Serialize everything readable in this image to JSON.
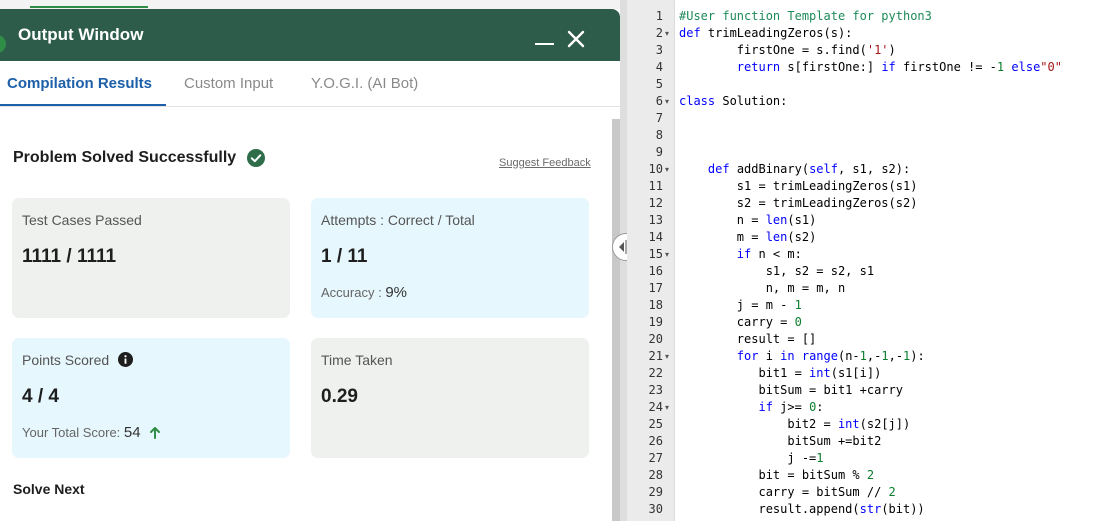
{
  "output_window": {
    "title": "Output Window",
    "tabs": [
      {
        "label": "Compilation Results",
        "active": true
      },
      {
        "label": "Custom Input",
        "active": false
      },
      {
        "label": "Y.O.G.I. (AI Bot)",
        "active": false
      }
    ]
  },
  "result": {
    "title": "Problem Solved Successfully",
    "feedback_link": "Suggest Feedback",
    "cards": [
      {
        "label": "Test Cases Passed",
        "value": "1111 / 1111"
      },
      {
        "label": "Attempts : Correct / Total",
        "value": "1 / 11",
        "sub_label": "Accuracy :",
        "sub_value": "9%"
      },
      {
        "label": "Points Scored",
        "value": "4 / 4",
        "sub_label": "Your Total Score:",
        "sub_value": "54"
      },
      {
        "label": "Time Taken",
        "value": "0.29"
      }
    ],
    "solve_next": "Solve Next"
  },
  "colors": {
    "header": "#2e5c4b",
    "active_tab": "#1d5fa8",
    "success": "#2f8d46",
    "card_gray": "#eef1ee",
    "card_blue": "#e6f7fd"
  },
  "icons": {
    "check": "check-circle-icon",
    "info": "info-icon",
    "arrow": "arrow-up-icon",
    "minimize": "minimize-icon",
    "close": "close-icon",
    "resize": "resize-handle-icon"
  },
  "editor": {
    "lines": [
      {
        "n": 1,
        "fold": false,
        "code": "#User function Template for python3"
      },
      {
        "n": 2,
        "fold": true,
        "code": "def trimLeadingZeros(s):"
      },
      {
        "n": 3,
        "fold": false,
        "code": "        firstOne = s.find('1')"
      },
      {
        "n": 4,
        "fold": false,
        "code": "        return s[firstOne:] if firstOne != -1 else\"0\""
      },
      {
        "n": 5,
        "fold": false,
        "code": ""
      },
      {
        "n": 6,
        "fold": true,
        "code": "class Solution:"
      },
      {
        "n": 7,
        "fold": false,
        "code": ""
      },
      {
        "n": 8,
        "fold": false,
        "code": ""
      },
      {
        "n": 9,
        "fold": false,
        "code": ""
      },
      {
        "n": 10,
        "fold": true,
        "code": "    def addBinary(self, s1, s2):"
      },
      {
        "n": 11,
        "fold": false,
        "code": "        s1 = trimLeadingZeros(s1)"
      },
      {
        "n": 12,
        "fold": false,
        "code": "        s2 = trimLeadingZeros(s2)"
      },
      {
        "n": 13,
        "fold": false,
        "code": "        n = len(s1)"
      },
      {
        "n": 14,
        "fold": false,
        "code": "        m = len(s2)"
      },
      {
        "n": 15,
        "fold": true,
        "code": "        if n < m:"
      },
      {
        "n": 16,
        "fold": false,
        "code": "            s1, s2 = s2, s1"
      },
      {
        "n": 17,
        "fold": false,
        "code": "            n, m = m, n"
      },
      {
        "n": 18,
        "fold": false,
        "code": "        j = m - 1"
      },
      {
        "n": 19,
        "fold": false,
        "code": "        carry = 0"
      },
      {
        "n": 20,
        "fold": false,
        "code": "        result = []"
      },
      {
        "n": 21,
        "fold": true,
        "code": "        for i in range(n-1,-1,-1):"
      },
      {
        "n": 22,
        "fold": false,
        "code": "           bit1 = int(s1[i])"
      },
      {
        "n": 23,
        "fold": false,
        "code": "           bitSum = bit1 +carry"
      },
      {
        "n": 24,
        "fold": true,
        "code": "           if j>= 0:"
      },
      {
        "n": 25,
        "fold": false,
        "code": "               bit2 = int(s2[j])"
      },
      {
        "n": 26,
        "fold": false,
        "code": "               bitSum +=bit2"
      },
      {
        "n": 27,
        "fold": false,
        "code": "               j -=1"
      },
      {
        "n": 28,
        "fold": false,
        "code": "           bit = bitSum % 2"
      },
      {
        "n": 29,
        "fold": false,
        "code": "           carry = bitSum // 2"
      },
      {
        "n": 30,
        "fold": false,
        "code": "           result.append(str(bit))"
      }
    ]
  }
}
